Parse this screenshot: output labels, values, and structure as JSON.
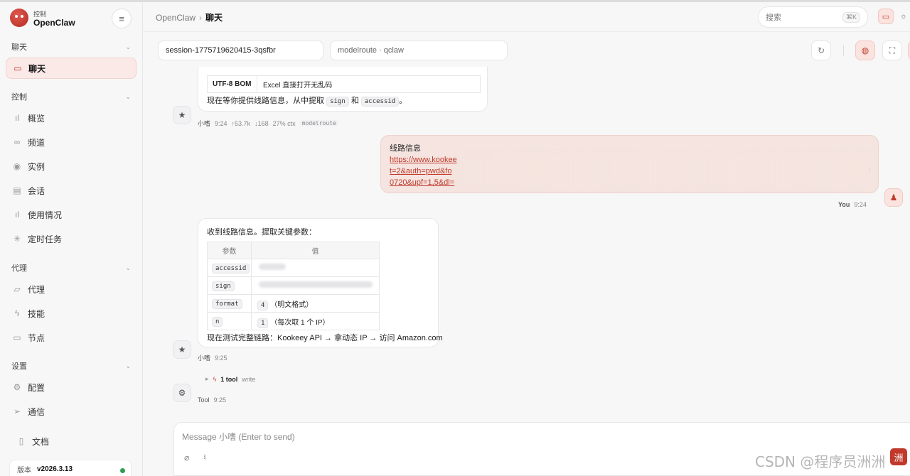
{
  "brand": {
    "subtitle": "控制",
    "title": "OpenClaw"
  },
  "sidebar": {
    "sections": [
      {
        "label": "聊天"
      },
      {
        "label": "控制"
      },
      {
        "label": "代理"
      },
      {
        "label": "设置"
      }
    ],
    "items": [
      {
        "label": "聊天",
        "icon": "chat-bubble-icon",
        "active": true
      },
      {
        "label": "概览",
        "icon": "bar-chart-icon"
      },
      {
        "label": "频道",
        "icon": "link-icon"
      },
      {
        "label": "实例",
        "icon": "radio-signal-icon"
      },
      {
        "label": "会话",
        "icon": "document-icon"
      },
      {
        "label": "使用情况",
        "icon": "bar-chart-icon"
      },
      {
        "label": "定时任务",
        "icon": "spinner-icon"
      },
      {
        "label": "代理",
        "icon": "folder-icon"
      },
      {
        "label": "技能",
        "icon": "lightning-icon"
      },
      {
        "label": "节点",
        "icon": "monitor-icon"
      },
      {
        "label": "配置",
        "icon": "gear-icon"
      },
      {
        "label": "通信",
        "icon": "send-icon"
      },
      {
        "label": "文档",
        "icon": "document-icon"
      }
    ],
    "version_label": "版本",
    "version_value": "v2026.3.13"
  },
  "header": {
    "breadcrumb_root": "OpenClaw",
    "breadcrumb_current": "聊天",
    "search_placeholder": "搜索",
    "search_shortcut": "⌘K"
  },
  "session": {
    "session_id": "session-1775719620415-3qsfbr",
    "model": "modelroute · qclaw"
  },
  "messages": {
    "first": {
      "table_row_key": "UTF-8 BOM",
      "table_row_value": "Excel 直接打开无乱码",
      "text_before": "现在等你提供线路信息，从中提取",
      "code_sign": "sign",
      "text_and": "和",
      "code_accessid": "accessid",
      "text_end": "。",
      "author": "小嗜",
      "time": "9:24",
      "tokens_up": "↑53.7k",
      "tokens_down": "↓168",
      "ctx": "27% ctx",
      "model_tag": "modelroute"
    },
    "user": {
      "title": "线路信息",
      "line1": "https://www.kookee",
      "line2": "t=2&auth=pwd&fo",
      "line2_tail": "!",
      "line3": "0720&upf=1,5&dl=",
      "author": "You",
      "time": "9:24"
    },
    "second": {
      "intro": "收到线路信息。提取关键参数：",
      "col_param": "参数",
      "col_value": "值",
      "rows": [
        {
          "param": "accessid",
          "value": ""
        },
        {
          "param": "sign",
          "value": ""
        },
        {
          "param": "format",
          "value_code": "4",
          "value_text": "（明文格式）"
        },
        {
          "param": "n",
          "value_code": "1",
          "value_text": "（每次取 1 个 IP）"
        }
      ],
      "outro": "现在测试完整链路：Kookeey API → 拿动态 IP → 访问 Amazon.com",
      "author": "小嗜",
      "time": "9:25"
    },
    "tool": {
      "count_label": "1 tool",
      "name": "write",
      "author": "Tool",
      "time": "9:25"
    }
  },
  "composer": {
    "placeholder": "Message 小嗜 (Enter to send)"
  },
  "watermark": {
    "text": "CSDN @程序员洲洲",
    "badge": "洲"
  }
}
